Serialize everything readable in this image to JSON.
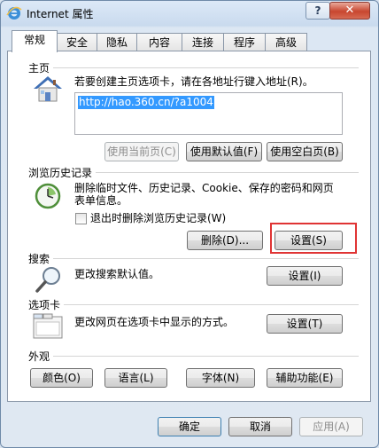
{
  "window": {
    "title": "Internet 属性",
    "help": "?",
    "close": "✕"
  },
  "tabs": [
    "常规",
    "安全",
    "隐私",
    "内容",
    "连接",
    "程序",
    "高级"
  ],
  "home": {
    "section": "主页",
    "description": "若要创建主页选项卡，请在各地址行键入地址(R)。",
    "url": "http://hao.360.cn/?a1004",
    "use_current": "使用当前页(C)",
    "use_default": "使用默认值(F)",
    "use_blank": "使用空白页(B)"
  },
  "history": {
    "section": "浏览历史记录",
    "description_line1": "删除临时文件、历史记录、Cookie、保存的密码和网页",
    "description_line2": "表单信息。",
    "checkbox_label": "退出时删除浏览历史记录(W)",
    "checkbox_checked": false,
    "delete": "删除(D)...",
    "settings": "设置(S)"
  },
  "search": {
    "section": "搜索",
    "description": "更改搜索默认值。",
    "settings": "设置(I)"
  },
  "tabs_section": {
    "section": "选项卡",
    "description": "更改网页在选项卡中显示的方式。",
    "settings": "设置(T)"
  },
  "appearance": {
    "section": "外观",
    "colors": "颜色(O)",
    "languages": "语言(L)",
    "fonts": "字体(N)",
    "accessibility": "辅助功能(E)"
  },
  "footer": {
    "ok": "确定",
    "cancel": "取消",
    "apply": "应用(A)"
  },
  "colors": {
    "selection": "#3399ff",
    "highlight_box": "#e03434"
  }
}
